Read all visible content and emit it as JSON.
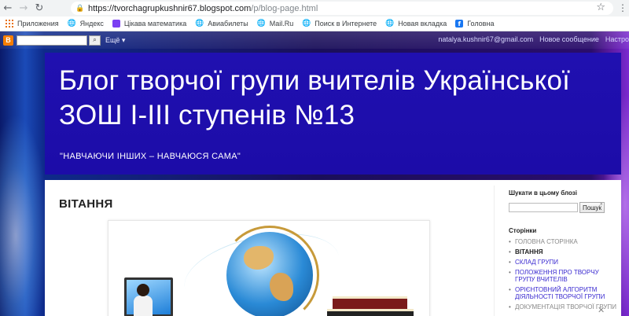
{
  "browser": {
    "url_host": "https://tvorchagrupkushnir67.blogspot.com",
    "url_path": "/p/blog-page.html",
    "bookmarks": [
      {
        "label": "Приложения",
        "icon": "apps-grid-icon"
      },
      {
        "label": "Яндекс",
        "icon": "globe-icon"
      },
      {
        "label": "Цікава математика",
        "icon": "purple-square-icon"
      },
      {
        "label": "Авиабилеты",
        "icon": "globe-icon"
      },
      {
        "label": "Mail.Ru",
        "icon": "globe-icon"
      },
      {
        "label": "Поиск в Интернете",
        "icon": "globe-icon"
      },
      {
        "label": "Новая вкладка",
        "icon": "globe-icon"
      },
      {
        "label": "Головна",
        "icon": "facebook-icon"
      }
    ]
  },
  "navbar": {
    "more_label": "Ещё",
    "email": "natalya.kushnir67@gmail.com",
    "new_post": "Новое сообщение",
    "settings": "Настро"
  },
  "header": {
    "title": "Блог творчої групи вчителів Української ЗОШ І-ІІІ ступенів №13",
    "description": "\"НАВЧАЮЧИ ІНШИХ – НАВЧАЮСЯ САМА\""
  },
  "post": {
    "title": "ВІТАННЯ"
  },
  "sidebar": {
    "search_heading": "Шукати в цьому блозі",
    "search_button": "Пошук",
    "pages_heading": "Сторінки",
    "pages": [
      {
        "label": "ГОЛОВНА СТОРІНКА",
        "state": "dim"
      },
      {
        "label": "ВІТАННЯ",
        "state": "active"
      },
      {
        "label": "СКЛАД ГРУПИ",
        "state": "link"
      },
      {
        "label": "ПОЛОЖЕННЯ ПРО ТВОРЧУ ГРУПУ ВЧИТЕЛІВ",
        "state": "link"
      },
      {
        "label": "ОРІЄНТОВНИЙ АЛГОРИТМ ДІЯЛЬНОСТІ ТВОРЧОЇ ГРУПИ",
        "state": "link"
      },
      {
        "label": "ДОКУМЕНТАЦІЯ ТВОРЧОЇ ГРУПИ",
        "state": "dim"
      }
    ]
  }
}
